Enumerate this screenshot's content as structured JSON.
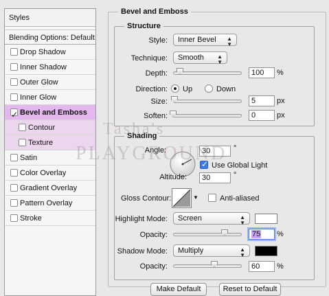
{
  "styles_panel": {
    "header": "Styles",
    "blending_options": "Blending Options: Default",
    "items": [
      {
        "label": "Drop Shadow",
        "checked": false
      },
      {
        "label": "Inner Shadow",
        "checked": false
      },
      {
        "label": "Outer Glow",
        "checked": false
      },
      {
        "label": "Inner Glow",
        "checked": false
      },
      {
        "label": "Bevel and Emboss",
        "checked": true,
        "active": true
      },
      {
        "label": "Contour",
        "checked": false,
        "sub": true
      },
      {
        "label": "Texture",
        "checked": false,
        "sub": true
      },
      {
        "label": "Satin",
        "checked": false
      },
      {
        "label": "Color Overlay",
        "checked": false
      },
      {
        "label": "Gradient Overlay",
        "checked": false
      },
      {
        "label": "Pattern Overlay",
        "checked": false
      },
      {
        "label": "Stroke",
        "checked": false
      }
    ]
  },
  "bevel": {
    "section_title": "Bevel and Emboss",
    "structure": {
      "title": "Structure",
      "style_label": "Style:",
      "style_value": "Inner Bevel",
      "technique_label": "Technique:",
      "technique_value": "Smooth",
      "depth_label": "Depth:",
      "depth_value": "100",
      "depth_unit": "%",
      "depth_level": 0.1,
      "direction_label": "Direction:",
      "direction_up": "Up",
      "direction_down": "Down",
      "direction_selected": "Up",
      "size_label": "Size:",
      "size_value": "5",
      "size_unit": "px",
      "size_level": 0.02,
      "soften_label": "Soften:",
      "soften_value": "0",
      "soften_unit": "px",
      "soften_level": 0.0
    },
    "shading": {
      "title": "Shading",
      "angle_label": "Angle:",
      "angle_value": "30",
      "angle_unit": "°",
      "use_global_light_label": "Use Global Light",
      "use_global_light": true,
      "altitude_label": "Altitude:",
      "altitude_value": "30",
      "altitude_unit": "°",
      "gloss_contour_label": "Gloss Contour:",
      "anti_aliased_label": "Anti-aliased",
      "anti_aliased": false,
      "highlight_mode_label": "Highlight Mode:",
      "highlight_mode_value": "Screen",
      "highlight_color": "#ffffff",
      "highlight_opacity_label": "Opacity:",
      "highlight_opacity_value": "75",
      "highlight_opacity_unit": "%",
      "highlight_opacity_level": 0.75,
      "shadow_mode_label": "Shadow Mode:",
      "shadow_mode_value": "Multiply",
      "shadow_color": "#000000",
      "shadow_opacity_label": "Opacity:",
      "shadow_opacity_value": "60",
      "shadow_opacity_unit": "%",
      "shadow_opacity_level": 0.6
    },
    "make_default_label": "Make Default",
    "reset_default_label": "Reset to Default"
  },
  "watermark": {
    "line1": "Tasha's",
    "line2": "Playground"
  },
  "colors": {
    "active_row": "#e4b8ee",
    "sub_row": "#ecd6ee",
    "checkbox_blue": "#3b7be8"
  }
}
